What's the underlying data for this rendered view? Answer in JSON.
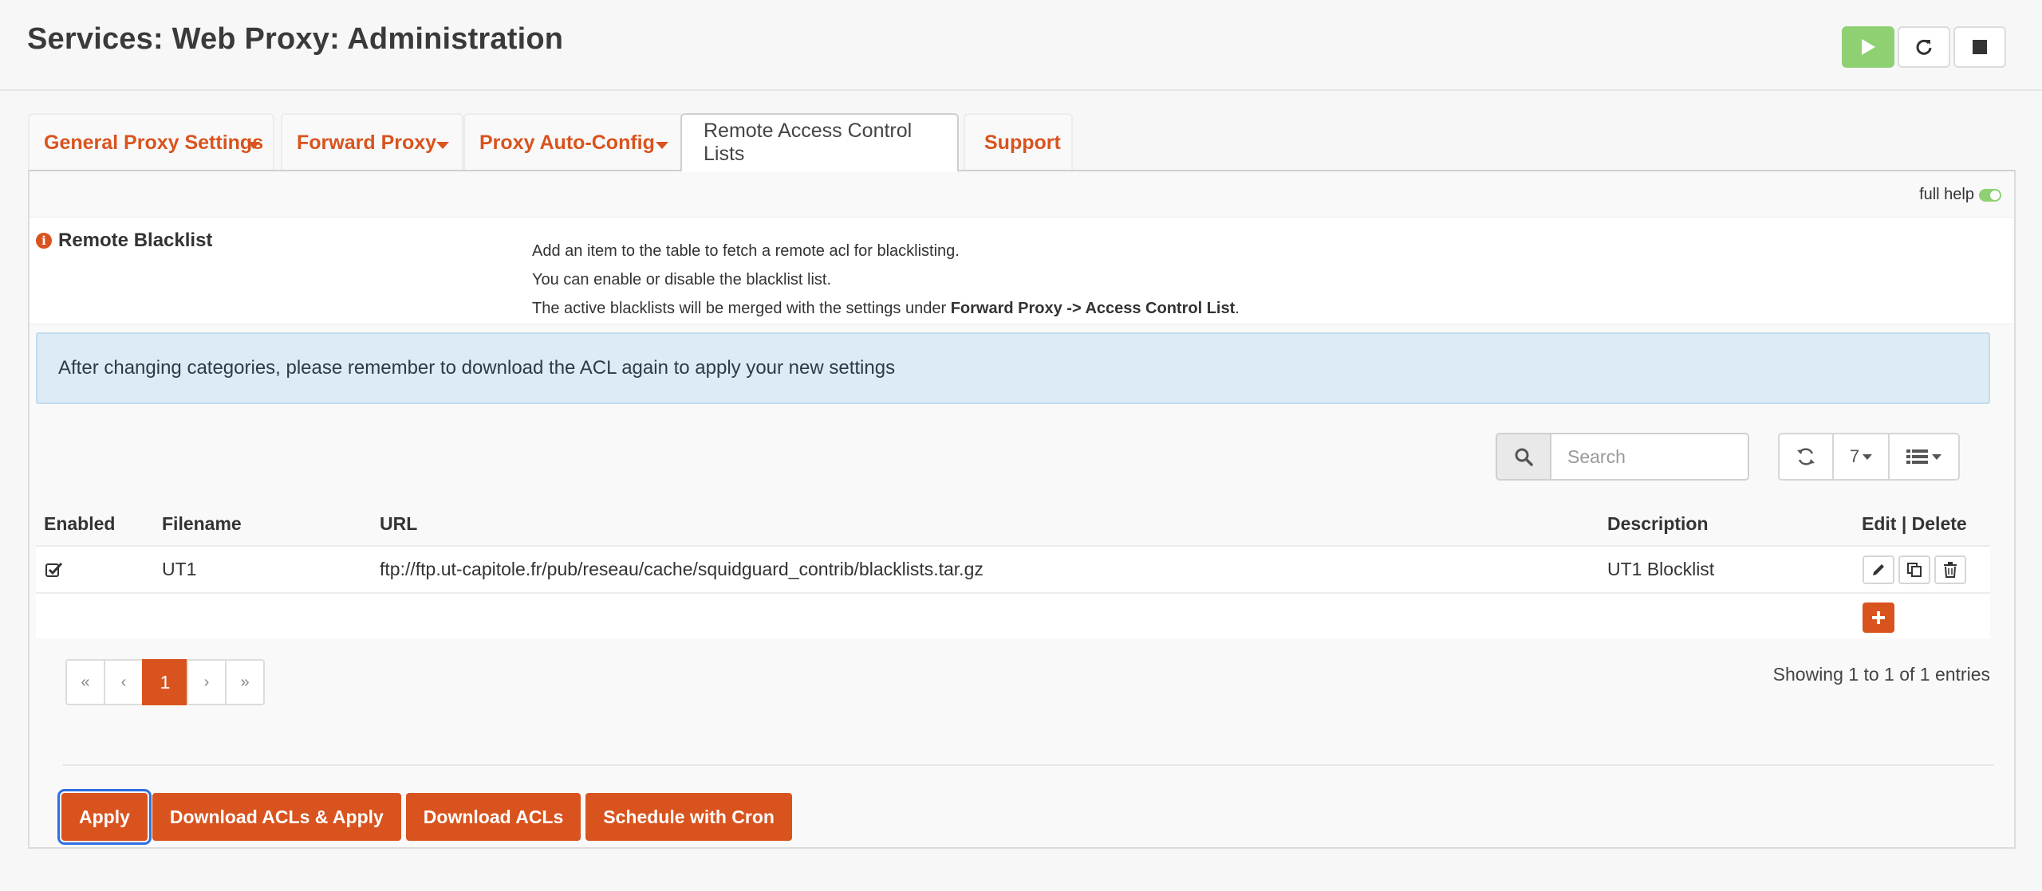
{
  "header": {
    "title": "Services: Web Proxy: Administration",
    "service_buttons": [
      {
        "icon": "play-icon",
        "color": "#8fd072"
      },
      {
        "icon": "restart-icon"
      },
      {
        "icon": "stop-icon"
      }
    ]
  },
  "tabs": [
    {
      "label": "General Proxy Settings",
      "dropdown": true
    },
    {
      "label": "Forward Proxy",
      "dropdown": true
    },
    {
      "label": "Proxy Auto-Config",
      "dropdown": true
    },
    {
      "label": "Remote Access Control Lists",
      "active": true
    },
    {
      "label": "Support"
    }
  ],
  "panel": {
    "full_help_label": "full help",
    "full_help_enabled": true,
    "help": {
      "label": "Remote Blacklist",
      "line1": "Add an item to the table to fetch a remote acl for blacklisting.",
      "line2": "You can enable or disable the blacklist list.",
      "line3_prefix": "The active blacklists will be merged with the settings under ",
      "line3_bold": "Forward Proxy -> Access Control List",
      "line3_suffix": "."
    },
    "alert": "After changing categories, please remember to download the ACL again to apply your new settings"
  },
  "grid": {
    "search_placeholder": "Search",
    "rows_per_page": "7",
    "columns": [
      "Enabled",
      "Filename",
      "URL",
      "Description",
      "Edit | Delete"
    ],
    "rows": [
      {
        "enabled": true,
        "filename": "UT1",
        "url": "ftp://ftp.ut-capitole.fr/pub/reseau/cache/squidguard_contrib/blacklists.tar.gz",
        "description": "UT1 Blocklist"
      }
    ],
    "pagination": [
      "«",
      "‹",
      "1",
      "›",
      "»"
    ],
    "current_page": "1",
    "showing": "Showing 1 to 1 of 1 entries"
  },
  "actions": {
    "apply": "Apply",
    "download_apply": "Download ACLs & Apply",
    "download": "Download ACLs",
    "schedule": "Schedule with Cron"
  },
  "colors": {
    "accent": "#d9531e",
    "success": "#8fd072",
    "alert_bg": "#dcebf6",
    "focus": "#2f6fe0"
  }
}
